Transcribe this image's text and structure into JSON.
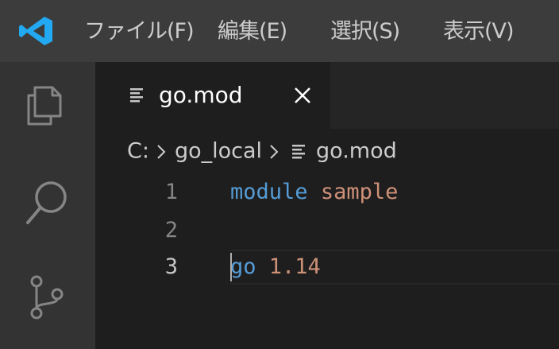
{
  "menu": {
    "items": [
      {
        "label": "ファイル(F)"
      },
      {
        "label": "編集(E)"
      },
      {
        "label": "選択(S)"
      },
      {
        "label": "表示(V)"
      }
    ]
  },
  "activity_bar": {
    "icons": [
      "files-icon",
      "search-icon",
      "source-control-icon"
    ]
  },
  "tab": {
    "label": "go.mod"
  },
  "breadcrumb": {
    "items": [
      "C:",
      "go_local",
      "go.mod"
    ]
  },
  "editor": {
    "lines": [
      {
        "number": "1",
        "tokens": [
          {
            "text": "module",
            "kind": "keyword"
          },
          {
            "text": " ",
            "kind": "plain"
          },
          {
            "text": "sample",
            "kind": "string"
          }
        ]
      },
      {
        "number": "2",
        "tokens": []
      },
      {
        "number": "3",
        "tokens": [
          {
            "text": "go",
            "kind": "keyword"
          },
          {
            "text": " ",
            "kind": "plain"
          },
          {
            "text": "1.14",
            "kind": "string"
          }
        ]
      }
    ],
    "active_line": "3"
  },
  "colors": {
    "titlebar": "#3c3c3c",
    "activitybar": "#333333",
    "editor_bg": "#1e1e1e",
    "keyword": "#569cd6",
    "string": "#ce9178",
    "logo": "#23a9f2"
  }
}
